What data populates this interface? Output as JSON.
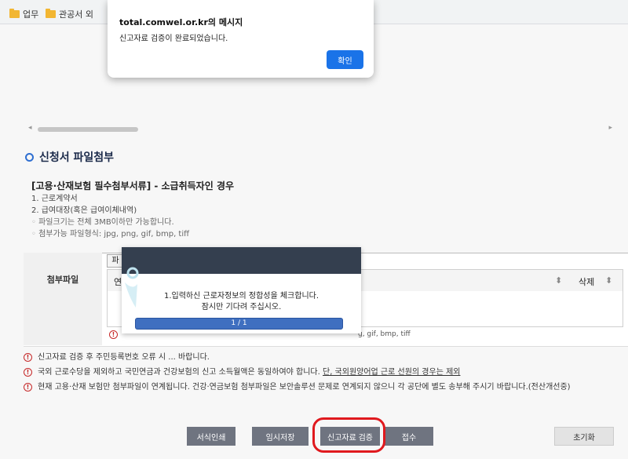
{
  "bookmarks": [
    {
      "label": "업무"
    },
    {
      "label": "관공서 외"
    }
  ],
  "section": {
    "title": "신청서 파일첨부"
  },
  "required_docs": {
    "heading": "[고용·산재보험 필수첨부서류] - 소급취득자인 경우",
    "items": [
      "1. 근로계약서",
      "2. 급여대장(혹은 급여이체내역)"
    ],
    "notes": [
      "파일크기는 전체 3MB이하만 가능합니다.",
      "첨부가능 파일형식: jpg, png, gif, bmp, tiff"
    ]
  },
  "attach": {
    "label": "첨부파일",
    "file_button": "파",
    "col_first": "연",
    "col_delete": "삭제",
    "formats_note": "g, gif, bmp, tiff"
  },
  "notices": [
    {
      "text": "신고자료 검증 후 주민등록번호 오류 시 ... 바랍니다.",
      "underline": ""
    },
    {
      "text": "국외 근로수당을 제외하고 국민연금과 건강보험의 신고 소득월액은 동일하여야 합니다. ",
      "underline": "단, 국외원양어업 근로 선원의 경우는 제외"
    },
    {
      "text": "현재 고용·산재 보험만 첨부파일이 연계됩니다. 건강·연금보험 첨부파일은 보안솔루션 문제로 연계되지 않으니 각 공단에 별도 송부해 주시기 바랍니다.(전산개선중)",
      "underline": ""
    }
  ],
  "buttons": {
    "print": "서식인쇄",
    "temp_save": "임시저장",
    "verify": "신고자료 검증",
    "submit": "접수",
    "reset": "초기화"
  },
  "progress": {
    "line1": "1.입력하신 근로자정보의 정합성을 체크합니다.",
    "line2": "잠시만 기다려 주십시오.",
    "counter": "1 / 1",
    "fraction": 1.0
  },
  "alert": {
    "origin": "total.comwel.or.kr의 메시지",
    "message": "신고자료 검증이 완료되었습니다.",
    "ok_label": "확인"
  },
  "colors": {
    "accent": "#1a73e8",
    "highlight_ring": "#e0191e",
    "dark_button": "#6f7480",
    "dialog_header": "#343f4f"
  }
}
